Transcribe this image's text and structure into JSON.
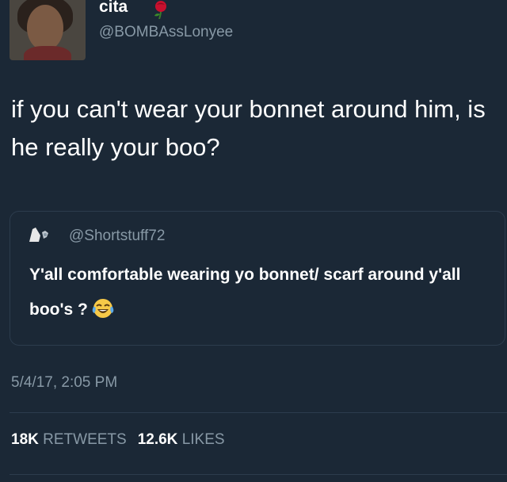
{
  "author": {
    "name": "cita",
    "handle": "@BOMBAssLonyee",
    "name_emoji": "rose-icon"
  },
  "tweet": {
    "text": "if you can't wear your bonnet around him, is he really your boo?"
  },
  "quoted_tweet": {
    "handle": "@Shortstuff72",
    "text": "Y'all comfortable wearing yo bonnet/ scarf around y'all boo's ?",
    "emoji": "tears-of-joy-emoji-icon"
  },
  "timestamp": "5/4/17, 2:05 PM",
  "stats": {
    "retweets_count": "18K",
    "retweets_label": "RETWEETS",
    "likes_count": "12.6K",
    "likes_label": "LIKES"
  },
  "colors": {
    "background": "#1b2836",
    "secondary_text": "#8899a6",
    "border": "#2c3c4d"
  }
}
